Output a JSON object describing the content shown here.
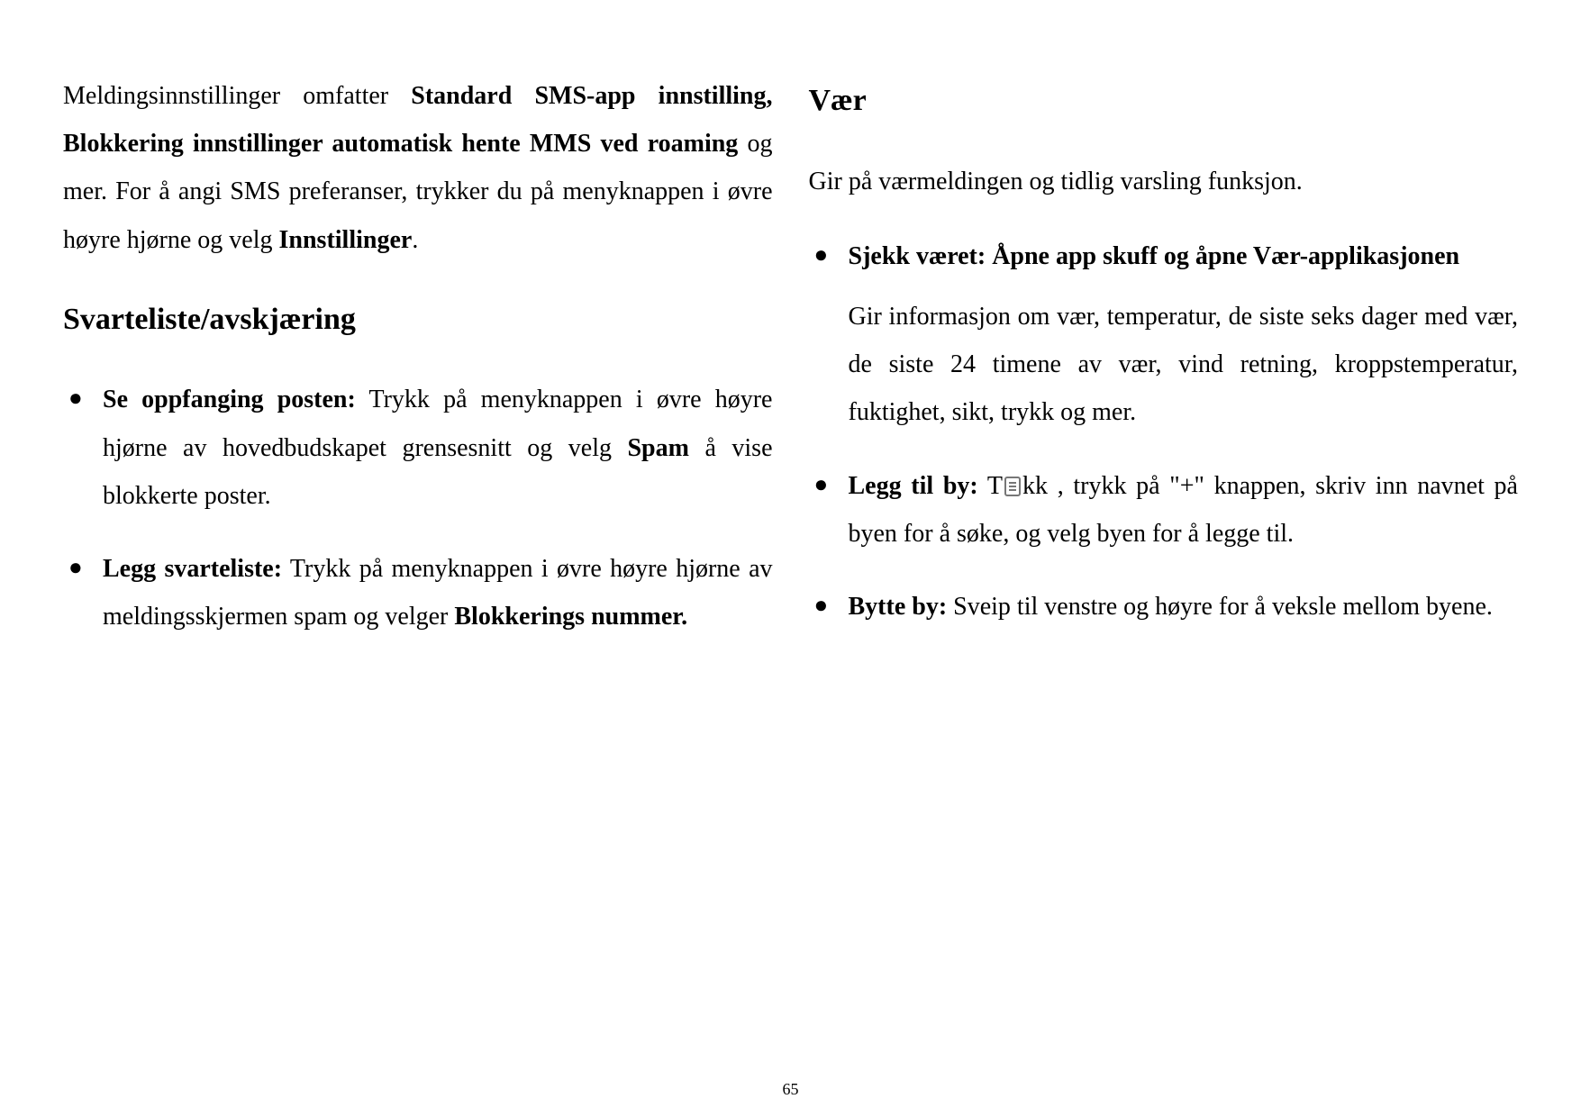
{
  "page_number": "65",
  "left": {
    "intro": {
      "pre": "Meldingsinnstillinger omfatter ",
      "bold1": "Standard SMS-app innstilling, Blokkering innstillinger automatisk hente MMS ved roaming",
      "post1": " og mer. For å angi SMS preferanser, trykker du på menyknappen i øvre høyre hjørne og velg ",
      "bold2": "Innstillinger",
      "post2": "."
    },
    "section_title": "Svarteliste/avskjæring",
    "items": [
      {
        "bold": "Se oppfanging posten:",
        "text_pre": " Trykk på menyknappen i øvre høyre hjørne av hovedbudskapet grensesnitt og velg ",
        "bold_inline": "Spam",
        "text_post": " å vise blokkerte poster."
      },
      {
        "bold": "Legg svarteliste:",
        "text_pre": " Trykk på menyknappen i øvre høyre hjørne av meldingsskjermen spam og velger ",
        "bold_inline": "Blokkerings nummer.",
        "text_post": ""
      }
    ]
  },
  "right": {
    "section_title": "Vær",
    "intro": "Gir på værmeldingen og tidlig varsling funksjon.",
    "items": [
      {
        "bold": "Sjekk været: Åpne app skuff og åpne Vær-applikasjonen",
        "sub": "Gir informasjon om vær, temperatur, de siste seks dager med vær, de siste 24 timene av vær, vind retning, kroppstemperatur, fuktighet, sikt, trykk og mer."
      },
      {
        "bold": "Legg til by:",
        "text_pre": " T",
        "text_mid": "kk ",
        "text_post": ", trykk på \"+\" knappen, skriv inn navnet på byen for å søke, og velg byen for å legge til."
      },
      {
        "bold": "Bytte by:",
        "text": " Sveip til venstre og høyre for å veksle mellom byene."
      }
    ]
  }
}
